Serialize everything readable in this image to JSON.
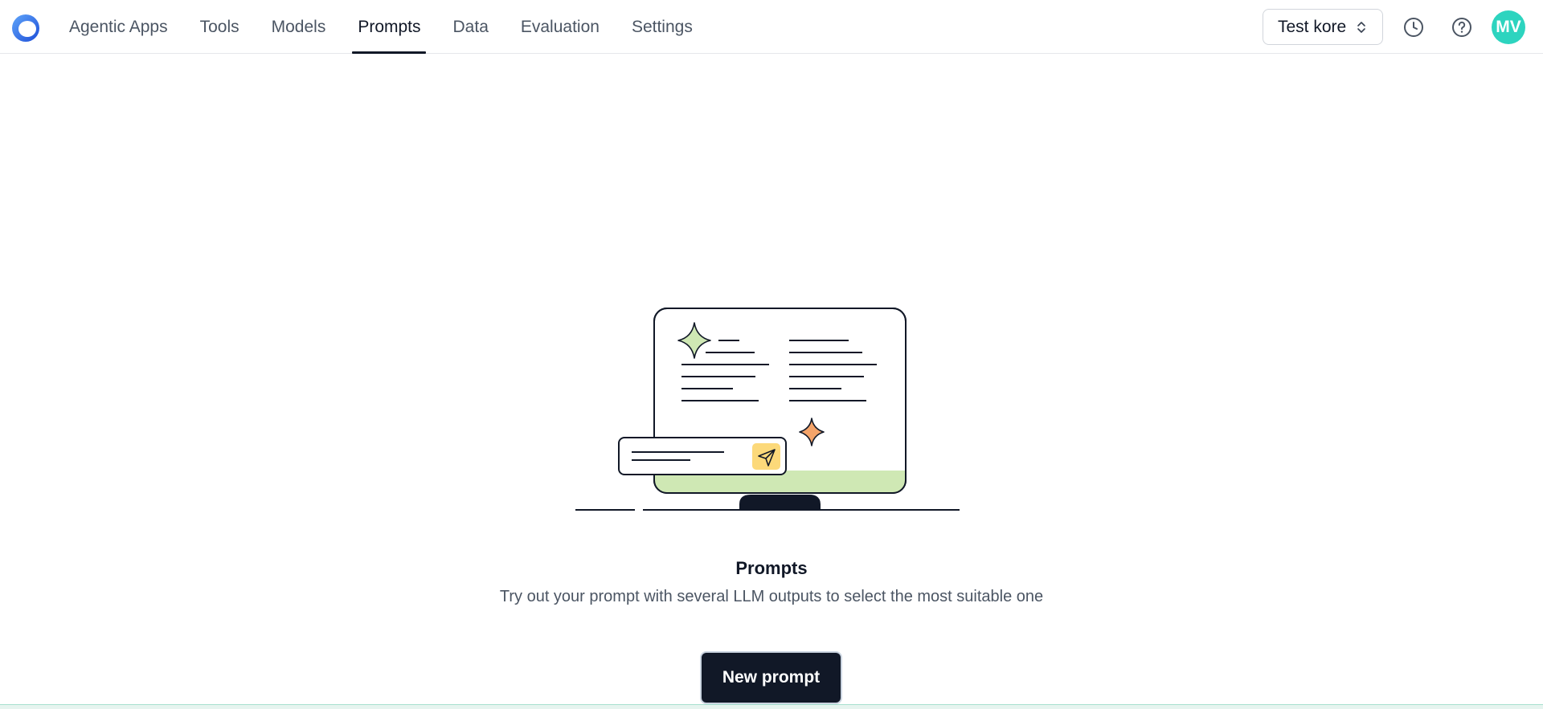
{
  "app": {
    "logo_icon": "app-logo-ring"
  },
  "nav": {
    "items": [
      {
        "label": "Agentic Apps",
        "active": false
      },
      {
        "label": "Tools",
        "active": false
      },
      {
        "label": "Models",
        "active": false
      },
      {
        "label": "Prompts",
        "active": true
      },
      {
        "label": "Data",
        "active": false
      },
      {
        "label": "Evaluation",
        "active": false
      },
      {
        "label": "Settings",
        "active": false
      }
    ]
  },
  "header_right": {
    "workspace_label": "Test kore",
    "workspace_icon": "chevron-up-down-icon",
    "history_icon": "clock-icon",
    "help_icon": "help-circle-icon",
    "avatar_initials": "MV",
    "avatar_color": "#2dd4bf"
  },
  "empty_state": {
    "title": "Prompts",
    "description": "Try out your prompt with several LLM outputs to select the most suitable one",
    "button_label": "New prompt",
    "illustration": "monitor-with-prompt-input-illustration"
  },
  "colors": {
    "primary": "#111827",
    "accent_green": "#cfe8b4",
    "accent_orange": "#f4a46a",
    "accent_yellow": "#fcd97a",
    "logo_blue": "#2563eb"
  }
}
